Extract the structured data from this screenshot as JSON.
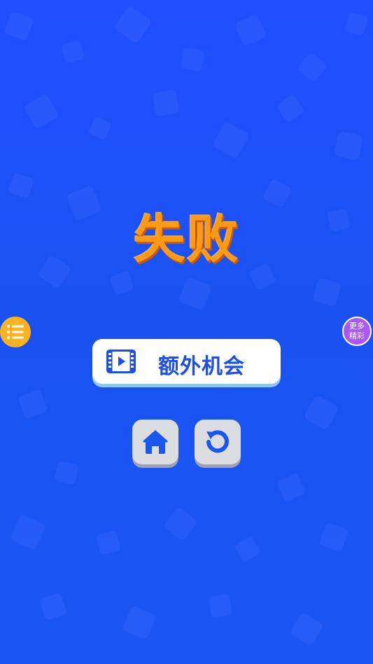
{
  "title": "失败",
  "extra_chance": {
    "label": "额外机会",
    "icon": "video-icon"
  },
  "side_left": {
    "icon": "list-menu-icon"
  },
  "side_right": {
    "line1": "更多",
    "line2": "精彩"
  },
  "buttons": {
    "home_icon": "home-icon",
    "retry_icon": "restart-icon"
  },
  "colors": {
    "background": "#1f4fff",
    "title": "#ff9a16",
    "accent_blue": "#1a4fe8",
    "left_side_button": "#ffb21f",
    "right_side_button": "#a957f5"
  }
}
